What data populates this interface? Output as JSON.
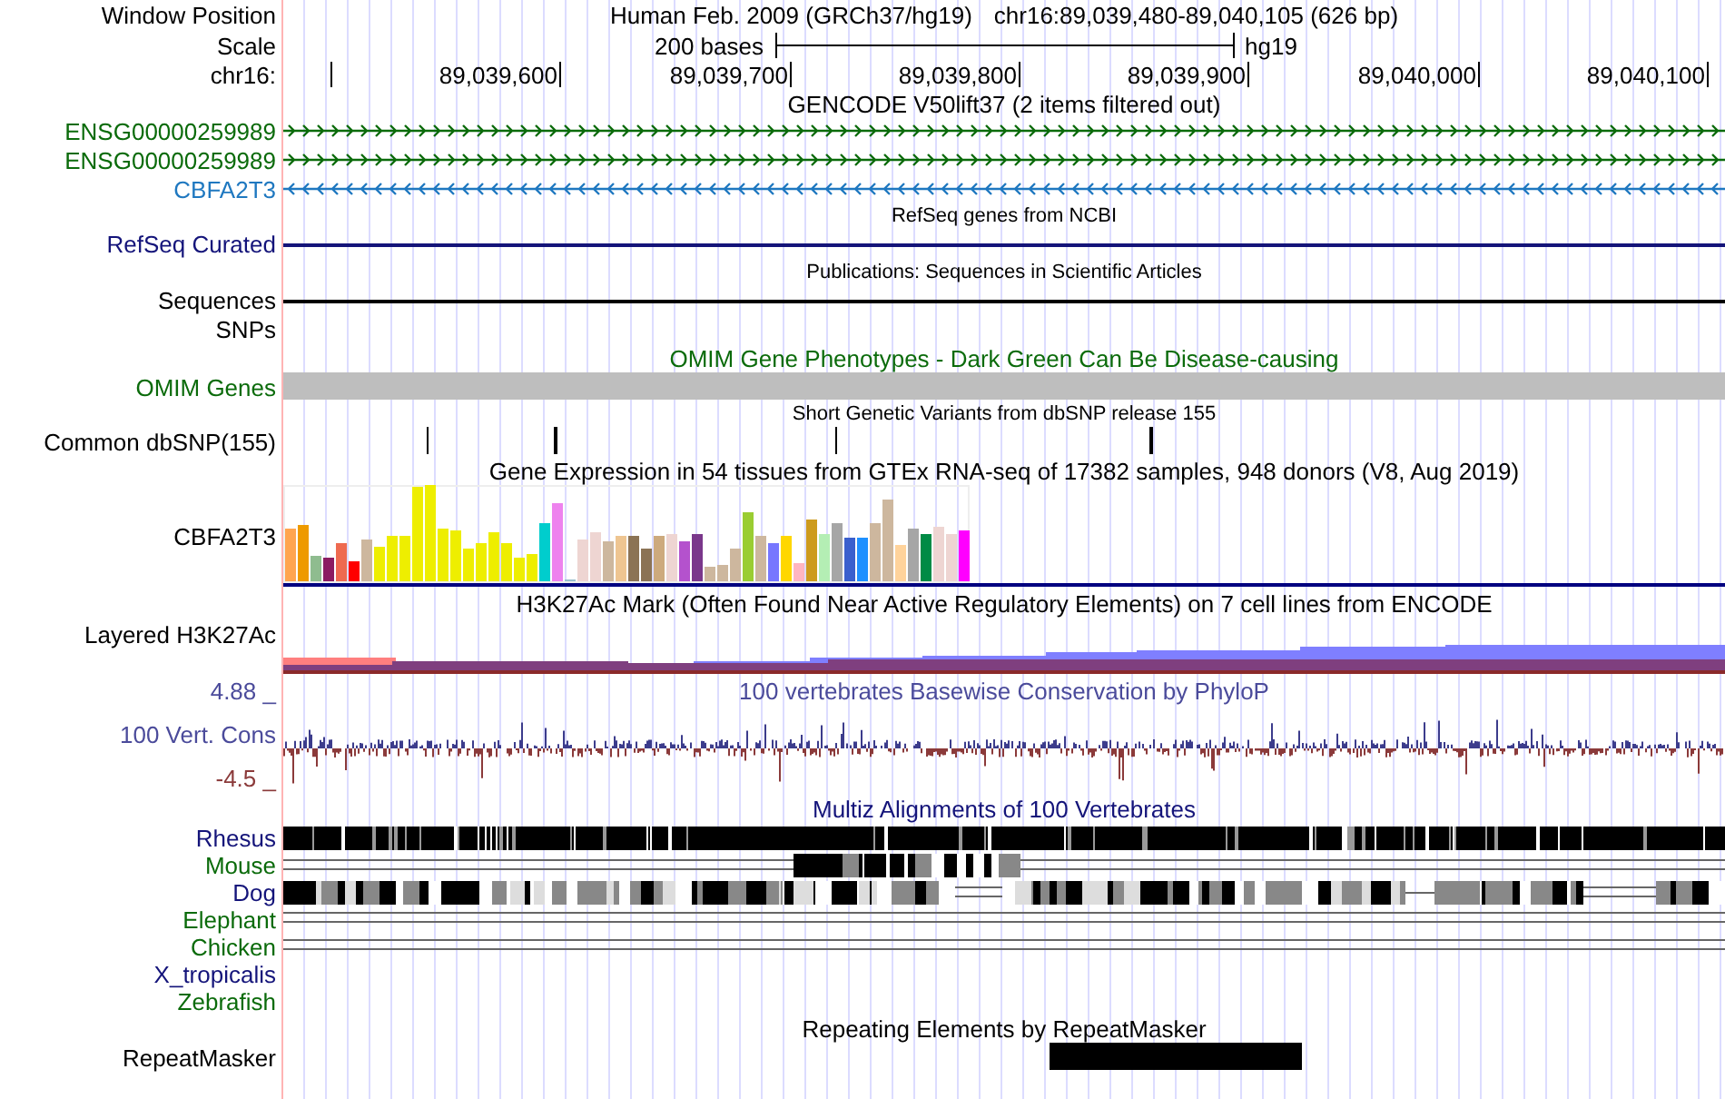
{
  "header": {
    "label": "Window Position",
    "title": "Human Feb. 2009 (GRCh37/hg19)",
    "position": "chr16:89,039,480-89,040,105 (626 bp)"
  },
  "scale": {
    "label": "Scale",
    "bar_text": "200 bases",
    "assembly": "hg19"
  },
  "ruler": {
    "label": "chr16:",
    "ticks": [
      "89,039,600",
      "89,039,700",
      "89,039,800",
      "89,039,900",
      "89,040,000",
      "89,040,100"
    ]
  },
  "tracks": [
    {
      "kind": "gene_group",
      "title": "GENCODE V50lift37 (2 items filtered out)",
      "genes": [
        {
          "name": "ENSG00000259989",
          "reverse_strand": false,
          "color": "#0b6b0b"
        },
        {
          "name": "ENSG00000259989",
          "reverse_strand": false,
          "color": "#0b6b0b"
        },
        {
          "name": "CBFA2T3",
          "reverse_strand": true,
          "color": "#1f78c0"
        }
      ]
    },
    {
      "kind": "line",
      "title": "RefSeq genes from NCBI",
      "label": "RefSeq Curated",
      "color": "#14147a"
    },
    {
      "kind": "line",
      "title": "Publications: Sequences in Scientific Articles",
      "label": "Sequences",
      "color": "#000000"
    },
    {
      "kind": "empty",
      "label": "SNPs",
      "color": "#000000"
    },
    {
      "kind": "bar",
      "title": "OMIM Gene Phenotypes - Dark Green Can Be Disease-causing",
      "title_colored": true,
      "label": "OMIM Genes",
      "color": "#0b6b0b"
    },
    {
      "kind": "snp",
      "title": "Short Genetic Variants from dbSNP release 155",
      "label": "Common dbSNP(155)",
      "color": "#000000"
    },
    {
      "kind": "expression",
      "title": "Gene Expression in 54 tissues from GTEx RNA-seq of 17382 samples, 948 donors (V8, Aug 2019)",
      "label": "CBFA2T3",
      "color": "#000000"
    },
    {
      "kind": "layered",
      "title": "H3K27Ac Mark (Often Found Near Active Regulatory Elements) on 7 cell lines from ENCODE",
      "label": "Layered H3K27Ac",
      "color": "#000000"
    },
    {
      "kind": "conservation",
      "title": "100 vertebrates Basewise Conservation by PhyloP",
      "title_colored": true,
      "label": "100 Vert. Cons",
      "color": "#4b4b9b",
      "axis_max": "4.88 _",
      "axis_min": "-4.5 _"
    },
    {
      "kind": "multiz",
      "title": "Multiz Alignments of 100 Vertebrates",
      "title_colored": true,
      "color": "#14147a",
      "species": [
        {
          "name": "Rhesus",
          "color": "#14147a",
          "kind": "aligned"
        },
        {
          "name": "Mouse",
          "color": "#0b6b0b",
          "kind": "partial"
        },
        {
          "name": "Dog",
          "color": "#14147a",
          "kind": "gapped"
        },
        {
          "name": "Elephant",
          "color": "#0b6b0b",
          "kind": "lines"
        },
        {
          "name": "Chicken",
          "color": "#0b6b0b",
          "kind": "lines"
        },
        {
          "name": "X_tropicalis",
          "color": "#14147a",
          "kind": "none"
        },
        {
          "name": "Zebrafish",
          "color": "#0b6b0b",
          "kind": "none"
        }
      ]
    },
    {
      "kind": "repeat",
      "title": "Repeating Elements by RepeatMasker",
      "label": "RepeatMasker",
      "color": "#000000"
    }
  ]
}
